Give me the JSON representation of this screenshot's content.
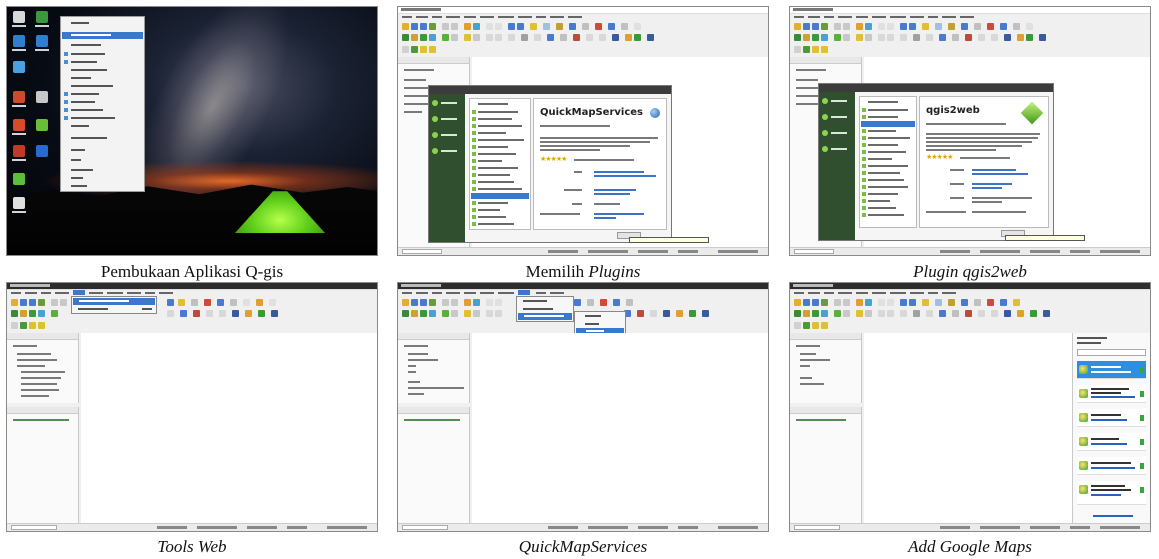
{
  "figure": {
    "captions": [
      {
        "text": "Pembukaan Aplikasi Q-gis",
        "italic": false
      },
      {
        "prefix": "Memilih ",
        "text": "Plugins",
        "italic": true
      },
      {
        "text": "Plugin qgis2web",
        "italic": true
      },
      {
        "text": "Tools Web",
        "italic": true
      },
      {
        "text": "QuickMapServices",
        "italic": true
      },
      {
        "text": "Add Google Maps",
        "italic": true
      }
    ],
    "plugin_titles": {
      "quickmapservices": "QuickMapServices",
      "qgis2web": "qgis2web"
    },
    "colors": {
      "selection": "#3a78d0",
      "tent": "#5fcf1a",
      "plugin_sidebar": "#2f4f2f",
      "rating": "#e2a400"
    },
    "icons": [
      "star-icon",
      "plugin-logo-icon",
      "tent-image"
    ]
  }
}
